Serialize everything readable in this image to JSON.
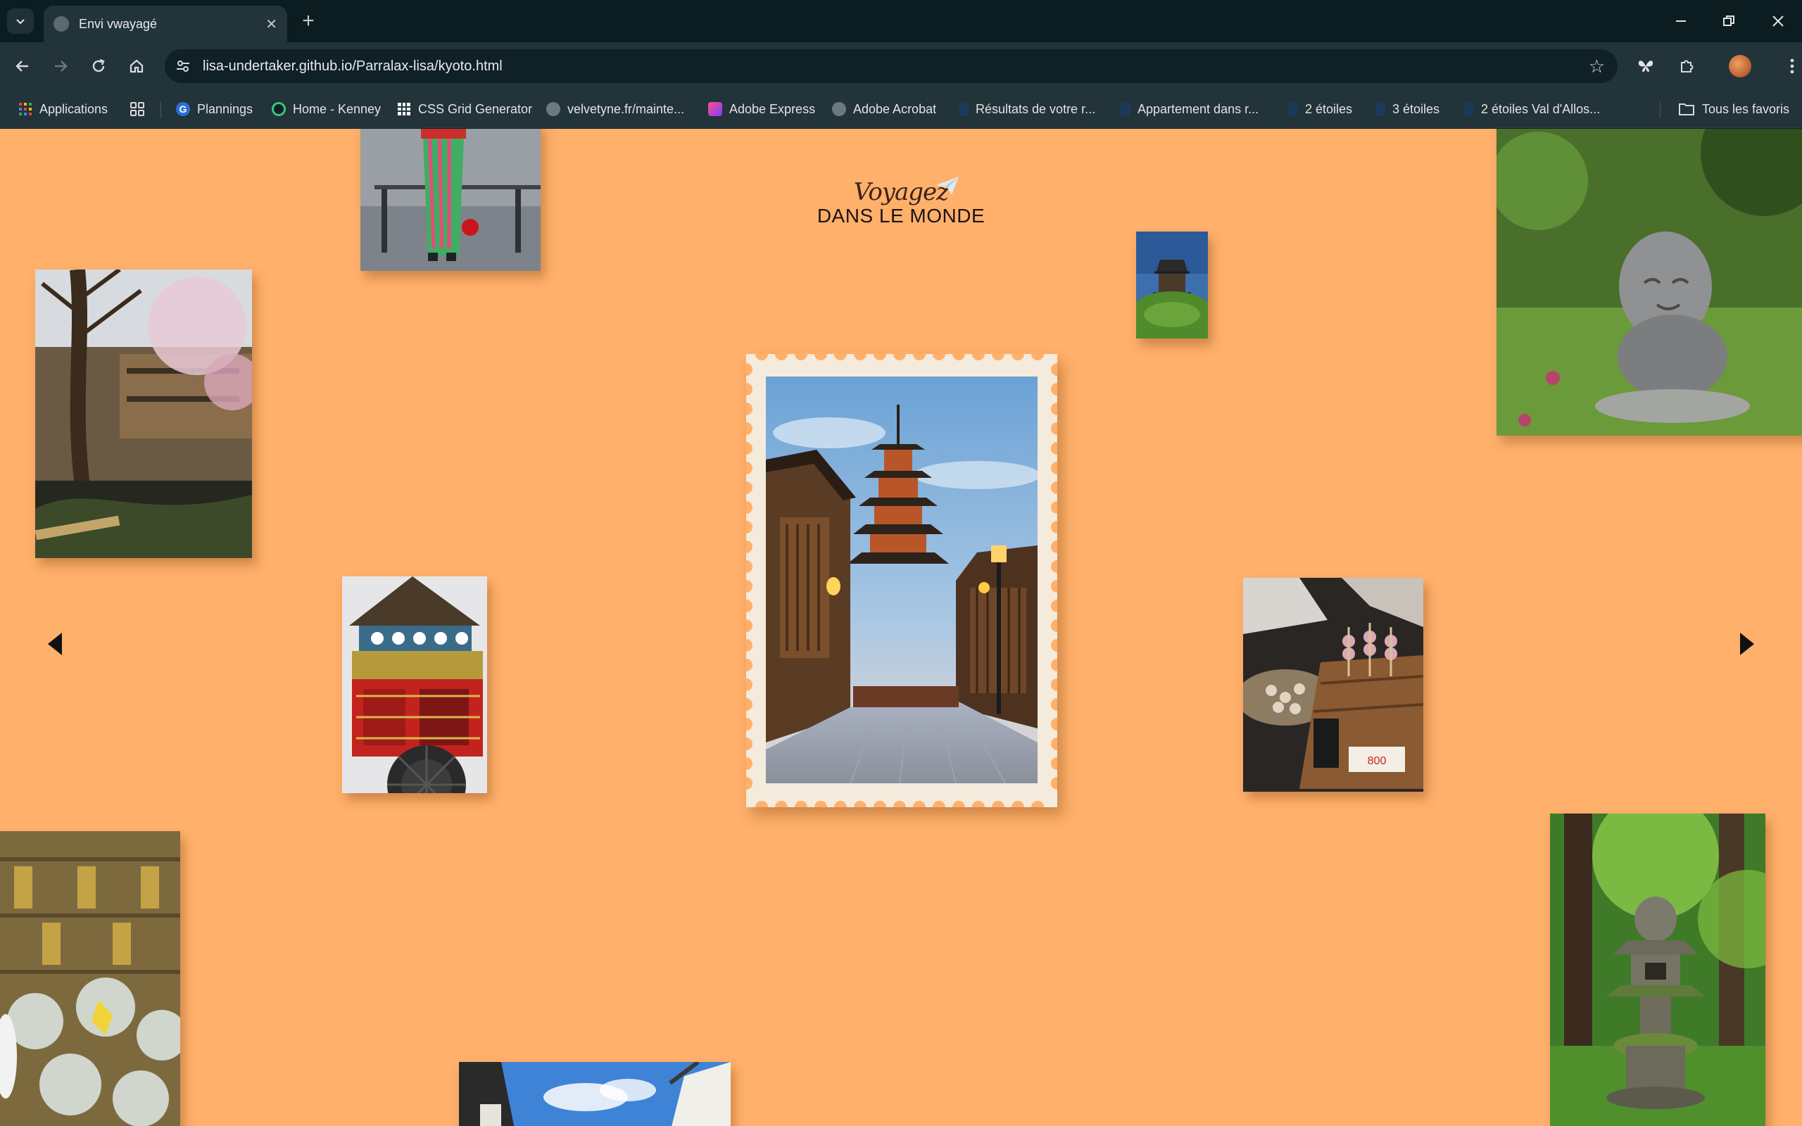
{
  "browser": {
    "tab_title": "Envi vwayagé",
    "url": "lisa-undertaker.github.io/Parralax-lisa/kyoto.html",
    "bookmarks": [
      {
        "label": "Applications"
      },
      {
        "label": "Plannings"
      },
      {
        "label": "Home - Kenney"
      },
      {
        "label": "CSS Grid Generator"
      },
      {
        "label": "velvetyne.fr/mainte..."
      },
      {
        "label": "Adobe Express"
      },
      {
        "label": "Adobe Acrobat"
      },
      {
        "label": "Résultats de votre r..."
      },
      {
        "label": "Appartement dans r..."
      },
      {
        "label": "2 étoiles"
      },
      {
        "label": "3 étoiles"
      },
      {
        "label": "2 étoiles Val d'Allos..."
      }
    ],
    "all_bookmarks": "Tous les favoris"
  },
  "page": {
    "background": "#ffb06b",
    "logo": {
      "script": "Voyagez",
      "main": "DANS LE MONDE"
    },
    "photos": [
      {
        "name": "photo-kimono",
        "subject": "kimono-street"
      },
      {
        "name": "photo-cherry-river",
        "subject": "cherry-blossom-canal"
      },
      {
        "name": "photo-castle",
        "subject": "castle-on-hill"
      },
      {
        "name": "photo-jizo-statue",
        "subject": "jizo-statue-moss"
      },
      {
        "name": "photo-float",
        "subject": "gion-festival-float"
      },
      {
        "name": "photo-mochi",
        "subject": "mochi-stall"
      },
      {
        "name": "photo-wind-chimes",
        "subject": "wind-chimes"
      },
      {
        "name": "photo-stone-lantern",
        "subject": "moss-stone-lantern"
      },
      {
        "name": "photo-temple-roof",
        "subject": "temple-roof-sky"
      }
    ],
    "stamp_subject": "yasaka-pagoda-street",
    "prev_icon": "caret-left-icon",
    "next_icon": "caret-right-icon"
  }
}
